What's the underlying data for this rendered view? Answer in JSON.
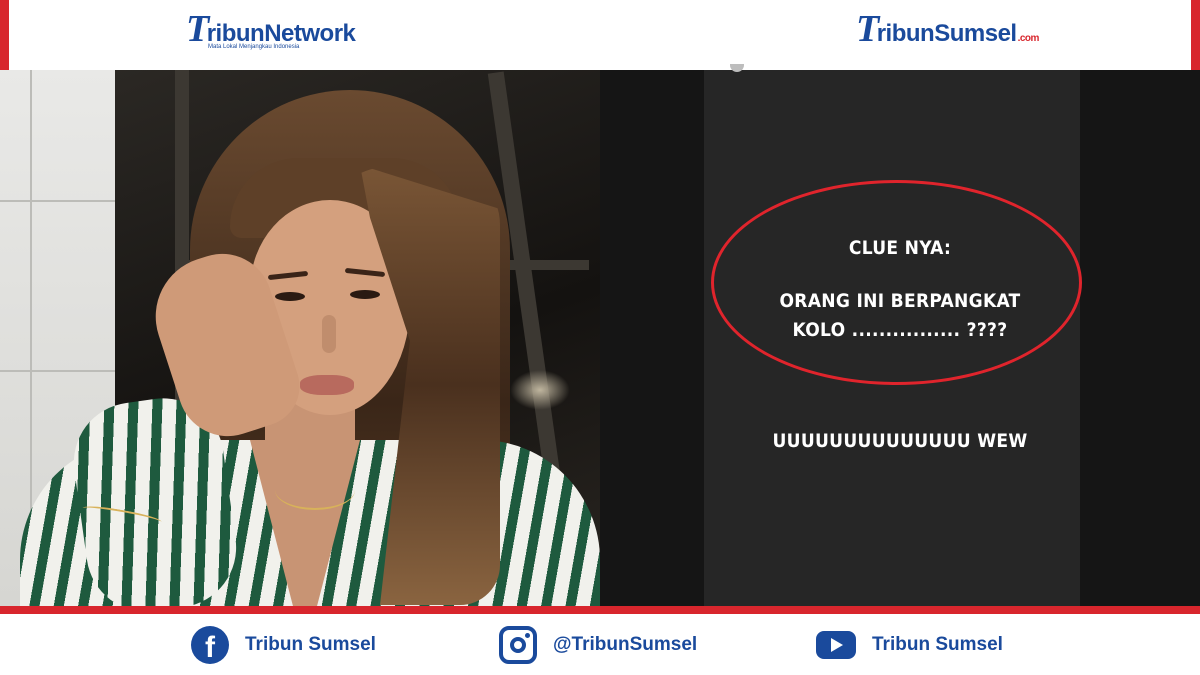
{
  "header": {
    "left_logo": {
      "mark": "T",
      "name": "ribunNetwork",
      "tagline": "Mata Lokal Menjangkau Indonesia"
    },
    "right_logo": {
      "mark": "T",
      "name": "ribunSumsel",
      "suffix": ".com"
    },
    "brand_color": "#1a4a9c",
    "accent_color": "#d8262d"
  },
  "story": {
    "clue_title": "CLUE NYA:",
    "clue_line1": "ORANG INI BERPANGKAT",
    "clue_line2": "KOLO ................ ????",
    "reaction": "UUUUUUUUUUUUUU WEW",
    "highlight_color": "#e0242c"
  },
  "footer": {
    "facebook": {
      "icon": "facebook-icon",
      "glyph": "f",
      "label": "Tribun Sumsel"
    },
    "instagram": {
      "icon": "instagram-icon",
      "label": "@TribunSumsel"
    },
    "youtube": {
      "icon": "youtube-icon",
      "label": "Tribun Sumsel"
    }
  }
}
